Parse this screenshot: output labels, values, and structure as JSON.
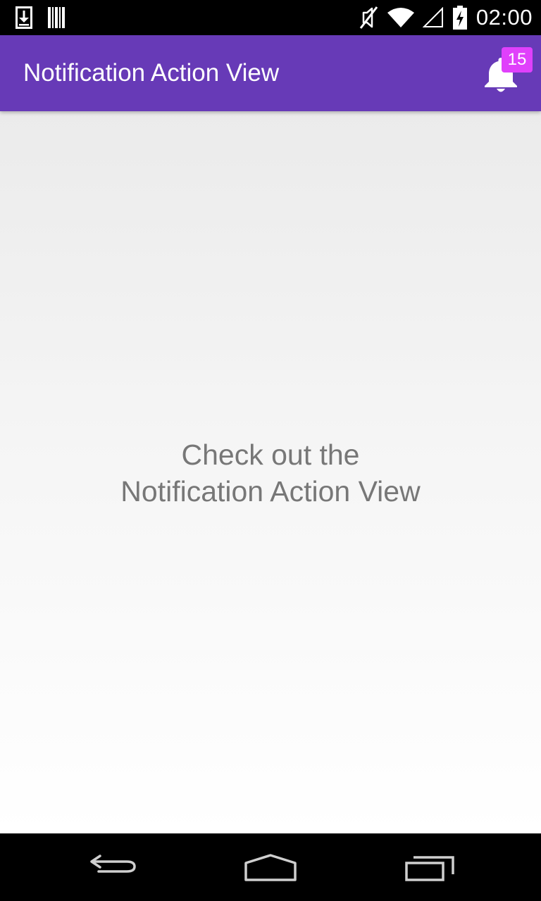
{
  "status_bar": {
    "time": "02:00",
    "icons": [
      "download-icon",
      "barcode-icon",
      "mute-icon",
      "wifi-icon",
      "signal-icon",
      "battery-charging-icon"
    ]
  },
  "app_bar": {
    "title": "Notification Action View",
    "background": "#673ab7",
    "notification": {
      "icon": "bell-icon",
      "badge_count": "15",
      "badge_color": "#e040fb"
    }
  },
  "content": {
    "message_line1": "Check out the",
    "message_line2": "Notification Action View"
  },
  "nav_bar": {
    "buttons": [
      "back-icon",
      "home-icon",
      "recents-icon"
    ]
  }
}
